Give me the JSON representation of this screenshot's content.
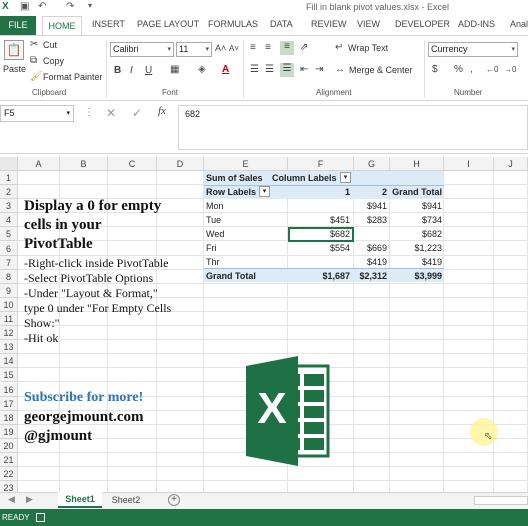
{
  "window": {
    "title": "Fill in blank pivot values.xlsx - Excel"
  },
  "ribbon_tabs": [
    "FILE",
    "HOME",
    "INSERT",
    "PAGE LAYOUT",
    "FORMULAS",
    "DATA",
    "REVIEW",
    "VIEW",
    "DEVELOPER",
    "ADD-INS",
    "Anal"
  ],
  "clipboard": {
    "paste": "Paste",
    "cut": "Cut",
    "copy": "Copy",
    "format_painter": "Format Painter",
    "label": "Clipboard"
  },
  "font": {
    "name": "Calibri",
    "size": "11",
    "label": "Font",
    "bold": "B",
    "italic": "I",
    "underline": "U"
  },
  "alignment": {
    "wrap_text": "Wrap Text",
    "merge_center": "Merge & Center",
    "label": "Alignment"
  },
  "number": {
    "format": "Currency",
    "label": "Number",
    "currency_sym": "$",
    "percent_sym": "%"
  },
  "formula_bar": {
    "cell_ref": "F5",
    "fx": "fx",
    "value": "682"
  },
  "columns": [
    "A",
    "B",
    "C",
    "D",
    "E",
    "F",
    "G",
    "H",
    "I",
    "J"
  ],
  "rows": [
    "1",
    "2",
    "3",
    "4",
    "5",
    "6",
    "7",
    "8",
    "9",
    "10",
    "11",
    "12",
    "13",
    "14",
    "15",
    "16",
    "17",
    "18",
    "19",
    "20",
    "21",
    "22",
    "23"
  ],
  "pivot": {
    "header_left": "Sum of Sales",
    "header_right": "Column Labels",
    "row_labels": "Row Labels",
    "col1": "1",
    "col2": "2",
    "grand_total_col": "Grand Total",
    "rows": [
      {
        "label": "Mon",
        "c1": "",
        "c2": "$941",
        "total": "$941"
      },
      {
        "label": "Tue",
        "c1": "$451",
        "c2": "$283",
        "total": "$734"
      },
      {
        "label": "Wed",
        "c1": "$682",
        "c2": "",
        "total": "$682"
      },
      {
        "label": "Fri",
        "c1": "$554",
        "c2": "$669",
        "total": "$1,223"
      },
      {
        "label": "Thr",
        "c1": "",
        "c2": "$419",
        "total": "$419"
      }
    ],
    "grand_total": {
      "label": "Grand Total",
      "c1": "$1,687",
      "c2": "$2,312",
      "total": "$3,999"
    }
  },
  "notes": {
    "heading1": "Display a 0 for empty",
    "heading2": "cells in your",
    "heading3": "PivotTable",
    "step1": "-Right-click inside PivotTable",
    "step2": "-Select PivotTable Options",
    "step3a": "-Under \"Layout & Format,\"",
    "step3b": "type 0 under \"For Empty Cells",
    "step3c": "Show:\"",
    "step4": "-Hit ok",
    "subscribe": "Subscribe for more!",
    "site": "georgejmount.com",
    "handle": "@gjmount"
  },
  "logo": {
    "letter": "X"
  },
  "sheets": {
    "active": "Sheet1",
    "other": "Sheet2",
    "add": "+"
  },
  "status": {
    "text": "READY"
  },
  "colors": {
    "excel_green": "#217346",
    "pivot_header": "#ddebf7",
    "subscribe_blue": "#2e75b6"
  }
}
